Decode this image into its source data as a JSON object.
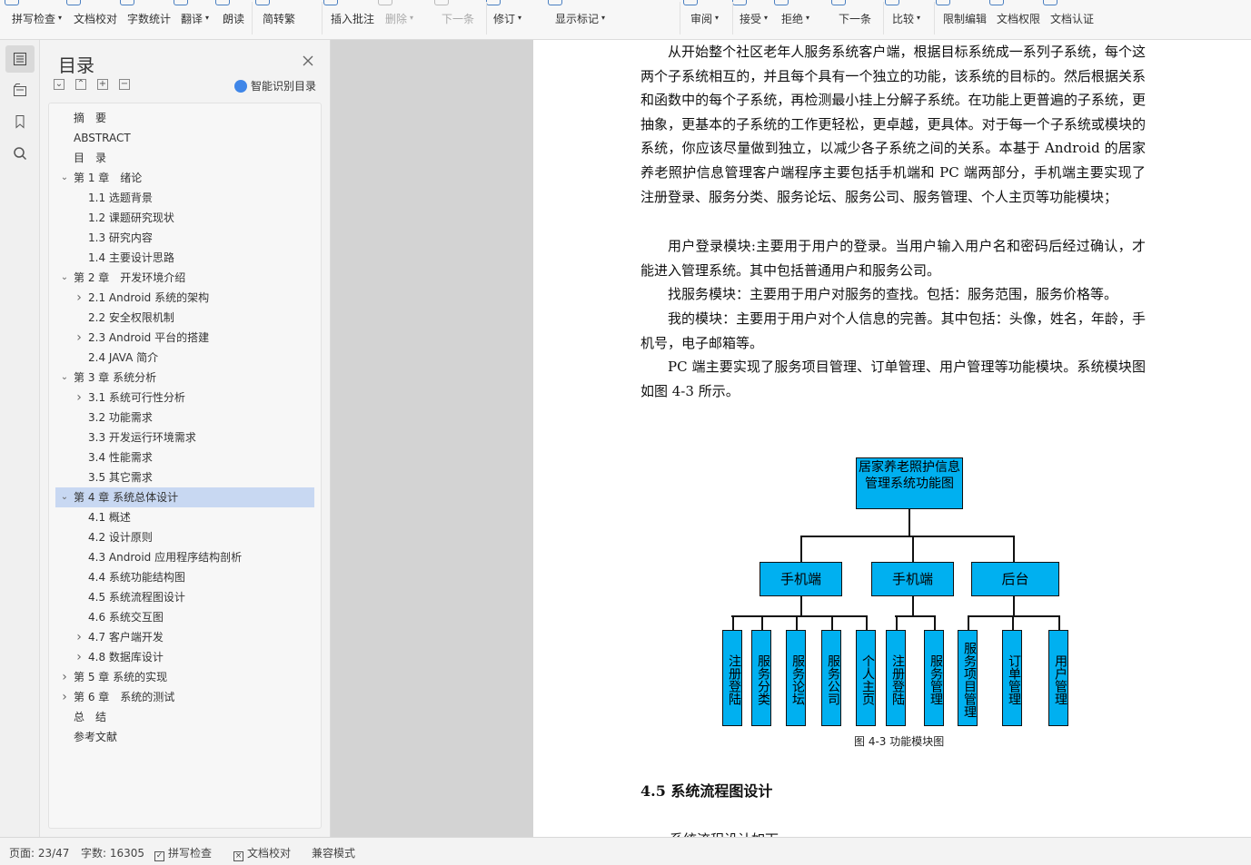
{
  "toolbar": {
    "items": [
      {
        "label": "拼写检查",
        "caret": true
      },
      {
        "label": "文档校对",
        "caret": false
      },
      {
        "label": "字数统计",
        "caret": false
      },
      {
        "label": "翻译",
        "caret": true
      },
      {
        "label": "朗读",
        "caret": false
      },
      {
        "label": "简转繁",
        "caret": false
      },
      {
        "label": "插入批注",
        "caret": false
      },
      {
        "label": "删除",
        "caret": true
      },
      {
        "label": "下一条",
        "caret": false
      },
      {
        "label": "修订",
        "caret": true
      },
      {
        "label": "显示标记",
        "caret": true
      },
      {
        "label": "审阅",
        "caret": true
      },
      {
        "label": "接受",
        "caret": true
      },
      {
        "label": "拒绝",
        "caret": true
      },
      {
        "label": "下一条",
        "caret": false
      },
      {
        "label": "比较",
        "caret": true
      },
      {
        "label": "限制编辑",
        "caret": false
      },
      {
        "label": "文档权限",
        "caret": false
      },
      {
        "label": "文档认证",
        "caret": false
      }
    ],
    "accent": "#4a7fc1"
  },
  "toc": {
    "title": "目录",
    "ai_label": "智能识别目录",
    "items": [
      {
        "text": "摘　要",
        "level": 0,
        "toggle": ""
      },
      {
        "text": "ABSTRACT",
        "level": 0,
        "toggle": ""
      },
      {
        "text": "目　录",
        "level": 0,
        "toggle": ""
      },
      {
        "text": "第 1 章　绪论",
        "level": 0,
        "toggle": "v"
      },
      {
        "text": "1.1  选题背景",
        "level": 1,
        "toggle": ""
      },
      {
        "text": "1.2  课题研究现状",
        "level": 1,
        "toggle": ""
      },
      {
        "text": "1.3  研究内容",
        "level": 1,
        "toggle": ""
      },
      {
        "text": "1.4  主要设计思路",
        "level": 1,
        "toggle": ""
      },
      {
        "text": "第 2 章　开发环境介绍",
        "level": 0,
        "toggle": "v"
      },
      {
        "text": "2.1 Android 系统的架构",
        "level": 1,
        "toggle": ">"
      },
      {
        "text": "2.2  安全权限机制",
        "level": 1,
        "toggle": ""
      },
      {
        "text": "2.3 Android 平台的搭建",
        "level": 1,
        "toggle": ">"
      },
      {
        "text": "2.4 JAVA 简介",
        "level": 1,
        "toggle": ""
      },
      {
        "text": "第 3 章  系统分析",
        "level": 0,
        "toggle": "v"
      },
      {
        "text": "3.1  系统可行性分析",
        "level": 1,
        "toggle": ">"
      },
      {
        "text": "3.2  功能需求",
        "level": 1,
        "toggle": ""
      },
      {
        "text": "3.3  开发运行环境需求",
        "level": 1,
        "toggle": ""
      },
      {
        "text": "3.4  性能需求",
        "level": 1,
        "toggle": ""
      },
      {
        "text": "3.5  其它需求",
        "level": 1,
        "toggle": ""
      },
      {
        "text": "第 4 章  系统总体设计",
        "level": 0,
        "toggle": "v",
        "selected": true
      },
      {
        "text": "4.1  概述",
        "level": 1,
        "toggle": ""
      },
      {
        "text": "4.2  设计原则",
        "level": 1,
        "toggle": ""
      },
      {
        "text": "4.3 Android 应用程序结构剖析",
        "level": 1,
        "toggle": ""
      },
      {
        "text": "4.4  系统功能结构图",
        "level": 1,
        "toggle": ""
      },
      {
        "text": "4.5  系统流程图设计",
        "level": 1,
        "toggle": ""
      },
      {
        "text": "4.6  系统交互图",
        "level": 1,
        "toggle": ""
      },
      {
        "text": "4.7  客户端开发",
        "level": 1,
        "toggle": ">"
      },
      {
        "text": "4.8  数据库设计",
        "level": 1,
        "toggle": ">"
      },
      {
        "text": "第 5 章  系统的实现",
        "level": 0,
        "toggle": ">"
      },
      {
        "text": "第 6 章　系统的测试",
        "level": 0,
        "toggle": ">"
      },
      {
        "text": "总　结",
        "level": 0,
        "toggle": ""
      },
      {
        "text": "参考文献",
        "level": 0,
        "toggle": ""
      }
    ],
    "selected_color": "#c8d8f2"
  },
  "document": {
    "paragraphs": [
      "从开始整个社区老年人服务系统客户端，根据目标系统成一系列子系统，每个这两个子系统相互的，并且每个具有一个独立的功能，该系统的目标的。然后根据关系和函数中的每个子系统，再检测最小挂上分解子系统。在功能上更普遍的子系统，更抽象，更基本的子系统的工作更轻松，更卓越，更具体。对于每一个子系统或模块的系统，你应该尽量做到独立，以减少各子系统之间的关系。本基于 Android 的居家养老照护信息管理客户端程序主要包括手机端和 PC 端两部分，手机端主要实现了注册登录、服务分类、服务论坛、服务公司、服务管理、个人主页等功能模块；",
      "用户登录模块:主要用于用户的登录。当用户输入用户名和密码后经过确认，才能进入管理系统。其中包括普通用户和服务公司。",
      "找服务模块：主要用于用户对服务的查找。包括：服务范围，服务价格等。",
      "我的模块：主要用于用户对个人信息的完善。其中包括：头像，姓名，年龄，手机号，电子邮箱等。",
      "PC 端主要实现了服务项目管理、订单管理、用户管理等功能模块。系统模块图如图 4-3 所示。"
    ],
    "diagram": {
      "root": "居家养老照护信息管理系统功能图",
      "level1": [
        "手机端",
        "手机端",
        "后台"
      ],
      "leaves": [
        "注册登陆",
        "服务分类",
        "服务论坛",
        "服务公司",
        "个人主页",
        "注册登陆",
        "服务管理",
        "服务项目管理",
        "订单管理",
        "用户管理"
      ],
      "fill_color": "#00b0f0"
    },
    "caption": "图 4-3  功能模块图",
    "heading": "4.5  系统流程图设计",
    "cut_line": "系统流程设计如下"
  },
  "status": {
    "page": "页面: 23/47",
    "words": "字数: 16305",
    "spell": "拼写检查",
    "proof": "文档校对",
    "mode": "兼容模式"
  }
}
